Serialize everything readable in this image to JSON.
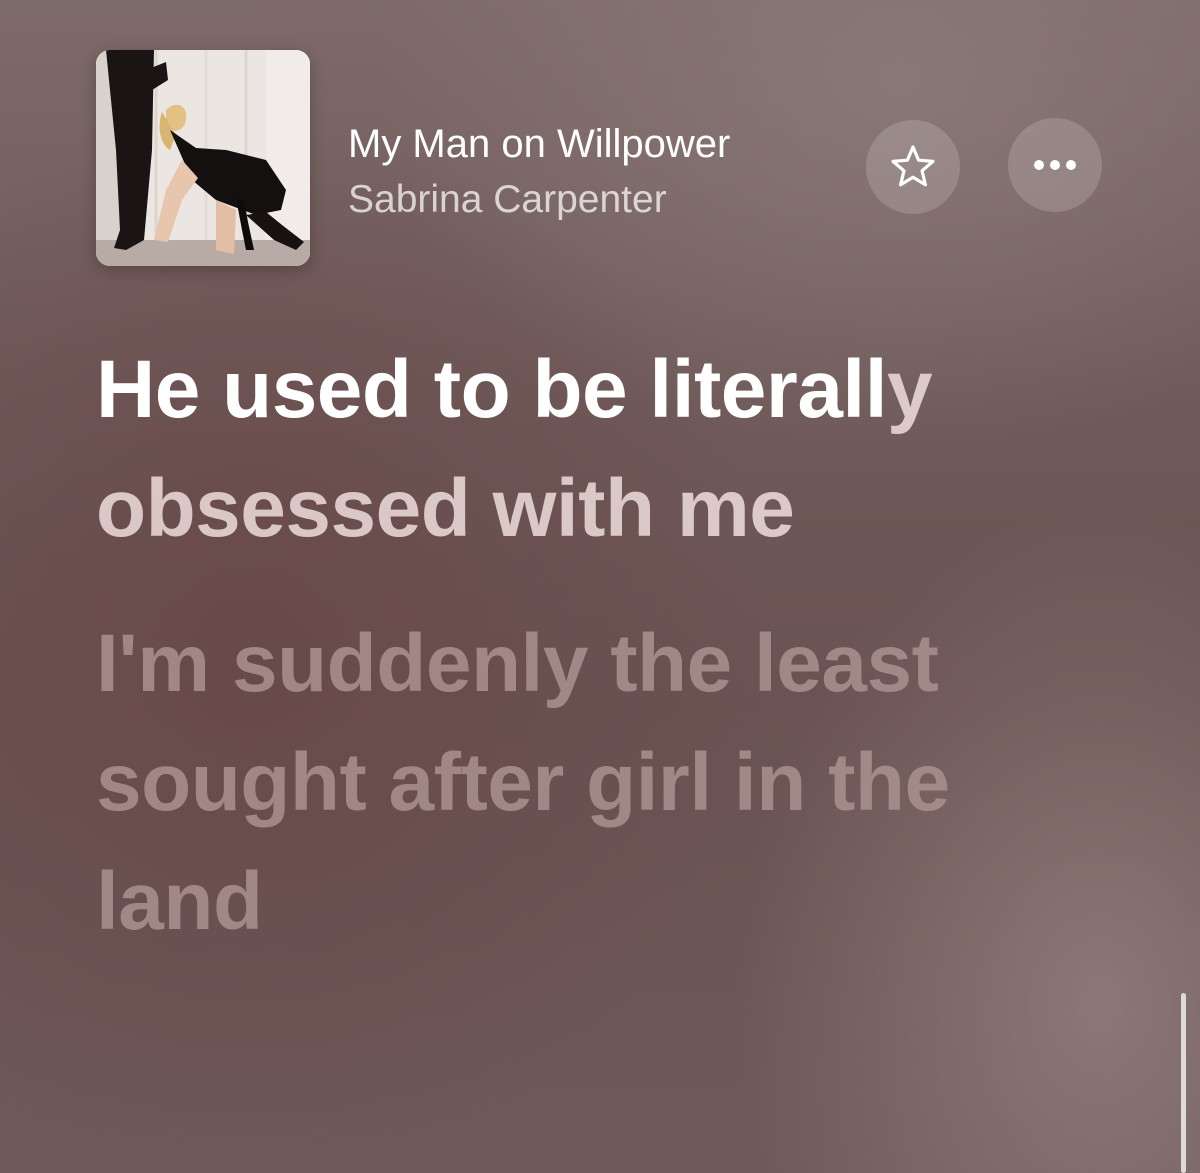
{
  "now_playing": {
    "title": "My Man on Willpower",
    "artist": "Sabrina Carpenter",
    "artwork_icon": "album-artwork"
  },
  "buttons": {
    "favorite_icon": "star-icon",
    "more_icon": "ellipsis-icon"
  },
  "lyrics": {
    "current_line": {
      "sung_text": "He used to be literall",
      "unsung_text": "y obsessed with me"
    },
    "next_line": {
      "text": "I'm suddenly the least sought after girl in the land"
    }
  },
  "colors": {
    "background": "#6e5a59",
    "sung_text": "#ffffff",
    "unsung_text": "#eededc",
    "upcoming_text": "#aa9290"
  }
}
